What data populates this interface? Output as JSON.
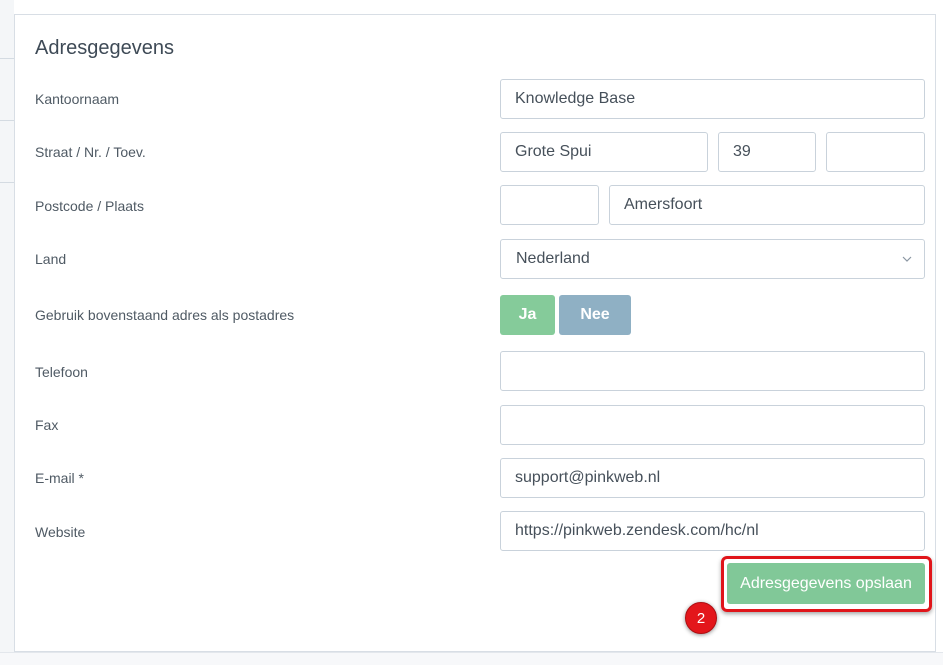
{
  "section_title": "Adresgegevens",
  "fields": {
    "kantoornaam": {
      "label": "Kantoornaam",
      "value": "Knowledge Base"
    },
    "straat": {
      "label": "Straat / Nr. / Toev.",
      "street": "Grote Spui",
      "number": "39",
      "addition": ""
    },
    "postcode": {
      "label": "Postcode / Plaats",
      "postcode": "",
      "city": "Amersfoort"
    },
    "land": {
      "label": "Land",
      "value": "Nederland"
    },
    "postadres": {
      "label": "Gebruik bovenstaand adres als postadres",
      "yes": "Ja",
      "no": "Nee"
    },
    "telefoon": {
      "label": "Telefoon",
      "value": ""
    },
    "fax": {
      "label": "Fax",
      "value": ""
    },
    "email": {
      "label": "E-mail *",
      "value": "support@pinkweb.nl"
    },
    "website": {
      "label": "Website",
      "value": "https://pinkweb.zendesk.com/hc/nl"
    }
  },
  "save_label": "Adresgegevens opslaan",
  "step_badge": "2",
  "colors": {
    "success": "#81c898",
    "toggle_off": "#8fb0c4",
    "annotation_red": "#e0151a"
  }
}
